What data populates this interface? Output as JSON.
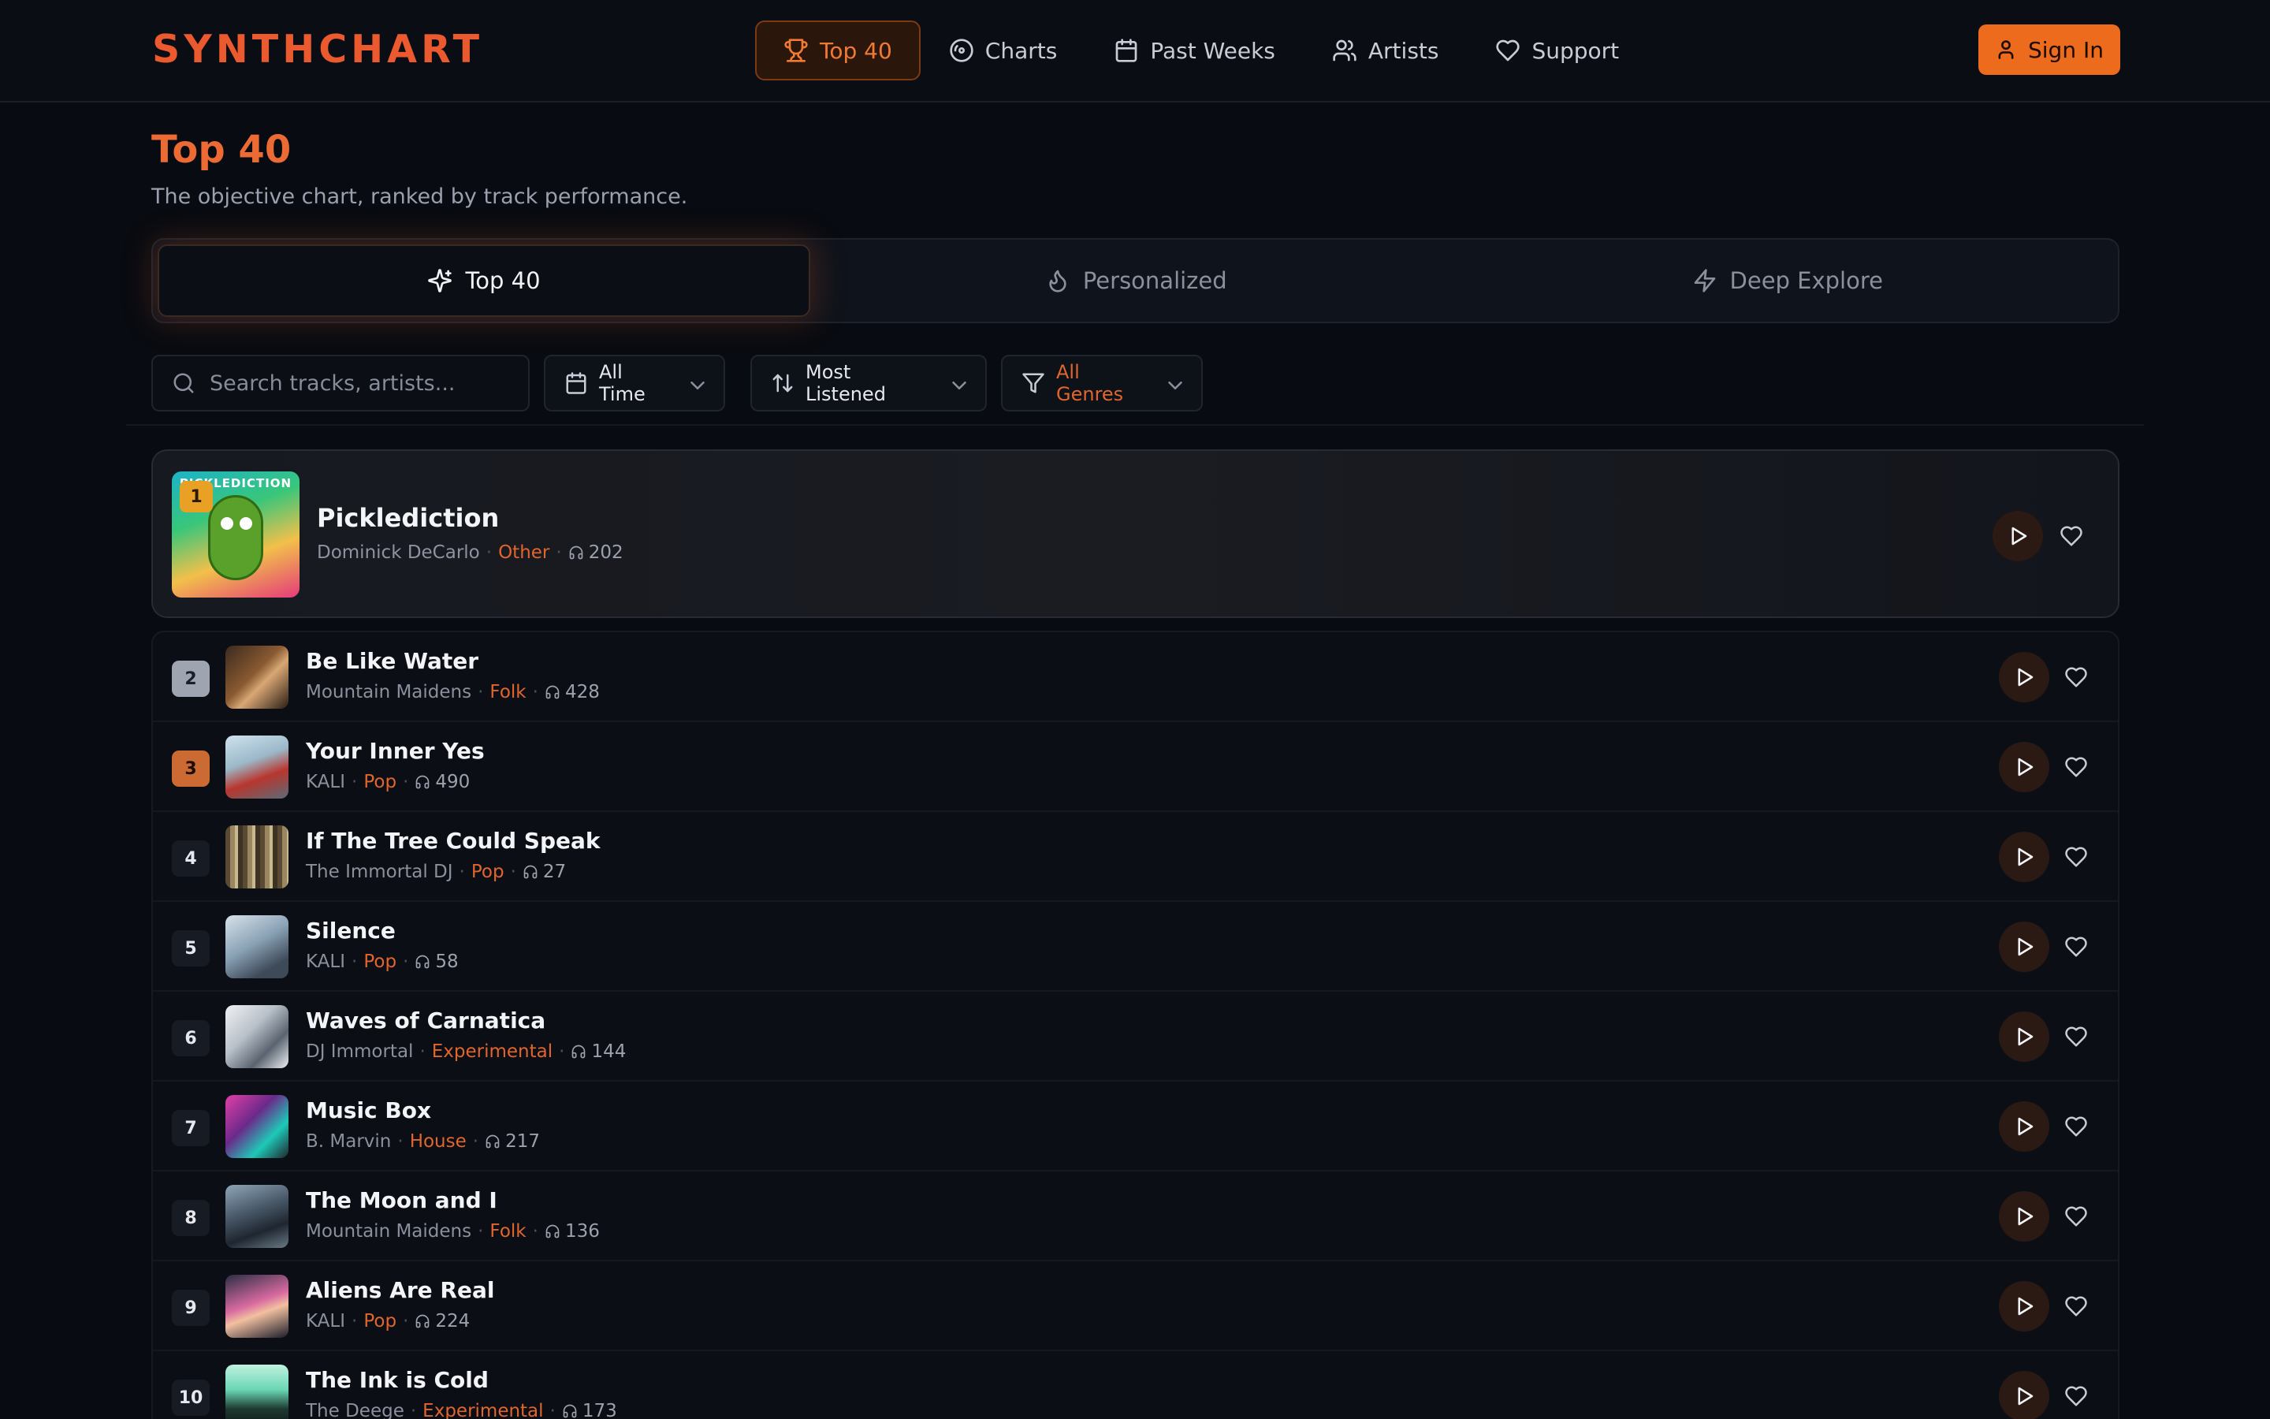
{
  "brand": "SYNTHCHART",
  "nav": [
    {
      "label": "Top 40",
      "icon": "trophy-icon",
      "active": true
    },
    {
      "label": "Charts",
      "icon": "disc-icon"
    },
    {
      "label": "Past Weeks",
      "icon": "calendar-icon"
    },
    {
      "label": "Artists",
      "icon": "users-icon"
    },
    {
      "label": "Support",
      "icon": "heart-icon"
    }
  ],
  "signin_label": "Sign In",
  "page": {
    "title": "Top 40",
    "subtitle": "The objective chart, ranked by track performance."
  },
  "modes": [
    {
      "label": "Top 40",
      "icon": "sparkles-icon",
      "active": true
    },
    {
      "label": "Personalized",
      "icon": "flame-icon"
    },
    {
      "label": "Deep Explore",
      "icon": "zap-icon"
    }
  ],
  "filters": {
    "search_placeholder": "Search tracks, artists...",
    "time": "All Time",
    "sort": "Most Listened",
    "genre": "All Genres"
  },
  "featured": {
    "rank": "1",
    "title": "Picklediction",
    "artist": "Dominick DeCarlo",
    "genre": "Other",
    "listens": "202",
    "art_text": "PICKLEDICTION"
  },
  "tracks": [
    {
      "rank": "2",
      "title": "Be Like Water",
      "artist": "Mountain Maidens",
      "genre": "Folk",
      "listens": "428"
    },
    {
      "rank": "3",
      "title": "Your Inner Yes",
      "artist": "KALI",
      "genre": "Pop",
      "listens": "490"
    },
    {
      "rank": "4",
      "title": "If The Tree Could Speak",
      "artist": "The Immortal DJ",
      "genre": "Pop",
      "listens": "27"
    },
    {
      "rank": "5",
      "title": "Silence",
      "artist": "KALI",
      "genre": "Pop",
      "listens": "58"
    },
    {
      "rank": "6",
      "title": "Waves of Carnatica",
      "artist": "DJ Immortal",
      "genre": "Experimental",
      "listens": "144"
    },
    {
      "rank": "7",
      "title": "Music Box",
      "artist": "B. Marvin",
      "genre": "House",
      "listens": "217"
    },
    {
      "rank": "8",
      "title": "The Moon and I",
      "artist": "Mountain Maidens",
      "genre": "Folk",
      "listens": "136"
    },
    {
      "rank": "9",
      "title": "Aliens Are Real",
      "artist": "KALI",
      "genre": "Pop",
      "listens": "224"
    },
    {
      "rank": "10",
      "title": "The Ink is Cold",
      "artist": "The Deege",
      "genre": "Experimental",
      "listens": "173"
    }
  ],
  "colors": {
    "accent": "#ec6b1c",
    "brand": "#ea5a2e",
    "gold": "#e8a125",
    "silver": "#9ea5b1",
    "bronze": "#cc6a33"
  }
}
